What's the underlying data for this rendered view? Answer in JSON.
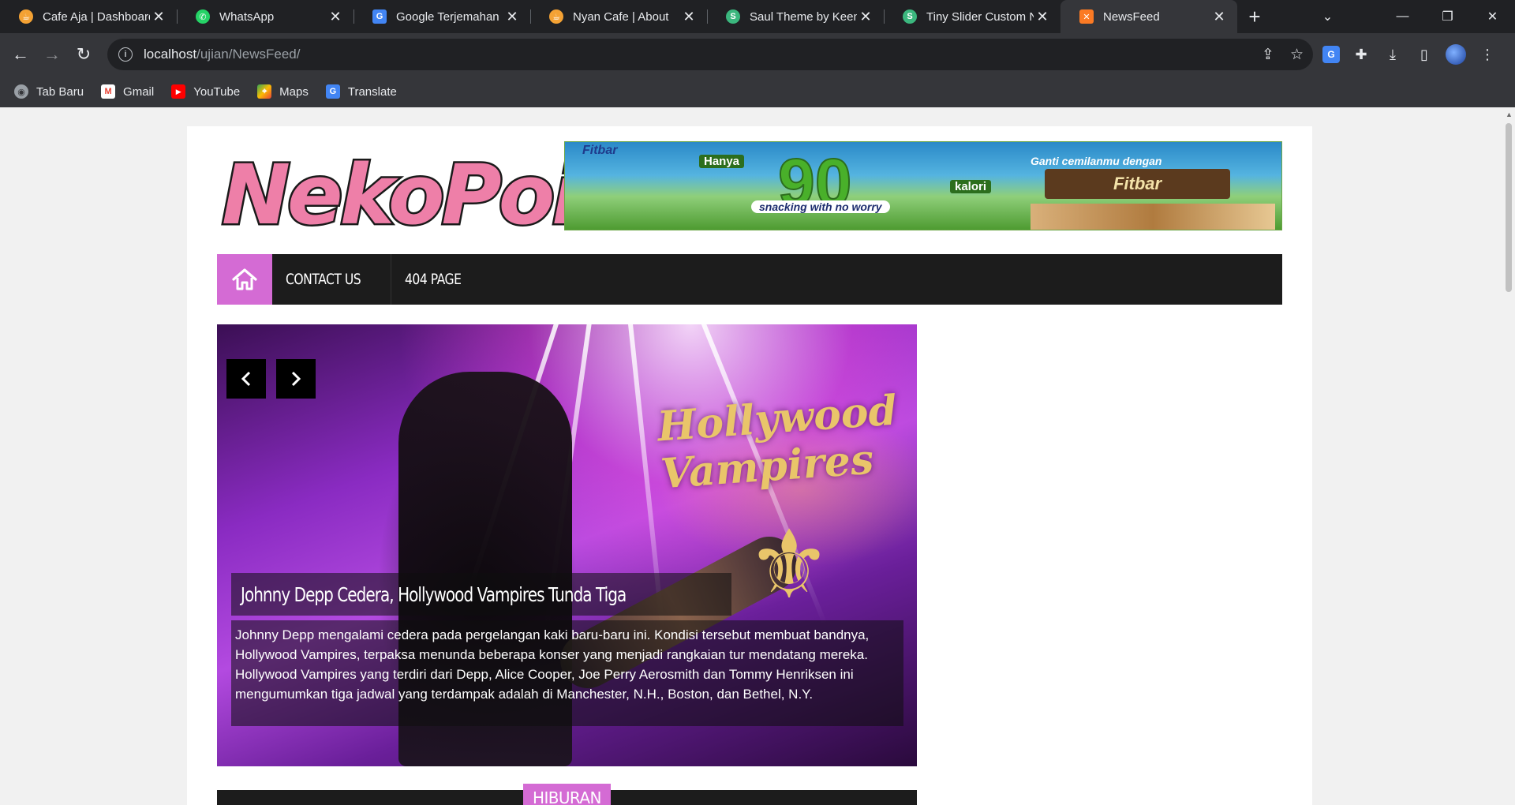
{
  "browser": {
    "tabs": [
      {
        "title": "Cafe Aja | Dashboard",
        "icon": "cafe-favicon",
        "color": "#f4a234"
      },
      {
        "title": "WhatsApp",
        "icon": "whatsapp-favicon",
        "color": "#25d366"
      },
      {
        "title": "Google Terjemahan",
        "icon": "google-translate-favicon",
        "color": "#4285f4"
      },
      {
        "title": "Nyan Cafe | About",
        "icon": "cafe-favicon",
        "color": "#f4a234"
      },
      {
        "title": "Saul Theme by Keenth",
        "icon": "saul-favicon",
        "color": "#3bb77e"
      },
      {
        "title": "Tiny Slider Custom Na",
        "icon": "saul-favicon",
        "color": "#3bb77e"
      },
      {
        "title": "NewsFeed",
        "icon": "xampp-favicon",
        "color": "#fb7a24"
      }
    ],
    "url_host": "localhost",
    "url_path": "/ujian/NewsFeed/",
    "bookmarks": [
      {
        "label": "Tab Baru",
        "icon": "globe-icon"
      },
      {
        "label": "Gmail",
        "icon": "gmail-icon"
      },
      {
        "label": "YouTube",
        "icon": "youtube-icon"
      },
      {
        "label": "Maps",
        "icon": "maps-icon"
      },
      {
        "label": "Translate",
        "icon": "google-translate-icon"
      }
    ]
  },
  "site": {
    "logo_text": "NekoPoi",
    "banner": {
      "brand": "Fitbar",
      "hanya": "Hanya",
      "number": "90",
      "kalori": "kalori",
      "tagline": "snacking with no worry",
      "cta": "Ganti cemilanmu dengan",
      "product": "Fitbar"
    },
    "nav": {
      "items": [
        {
          "label": "Contact Us"
        },
        {
          "label": "404 Page"
        }
      ]
    },
    "slider": {
      "band_text": "Hollywood Vampires",
      "title": "Johnny Depp Cedera, Hollywood Vampires Tunda Tiga",
      "body": "Johnny Depp mengalami cedera pada pergelangan kaki baru-baru ini. Kondisi tersebut membuat bandnya, Hollywood Vampires, terpaksa menunda beberapa konser yang menjadi rangkaian tur mendatang mereka. Hollywood Vampires yang terdiri dari Depp, Alice Cooper, Joe Perry Aerosmith dan Tommy Henriksen ini mengumumkan tiga jadwal yang terdampak adalah di Manchester, N.H., Boston, dan Bethel, N.Y."
    },
    "section": {
      "label": "HIBURAN"
    }
  },
  "colors": {
    "accent": "#d46bd4",
    "nav_bg": "#1c1c1c",
    "chrome_dark": "#202124",
    "chrome_toolbar": "#35363a"
  }
}
